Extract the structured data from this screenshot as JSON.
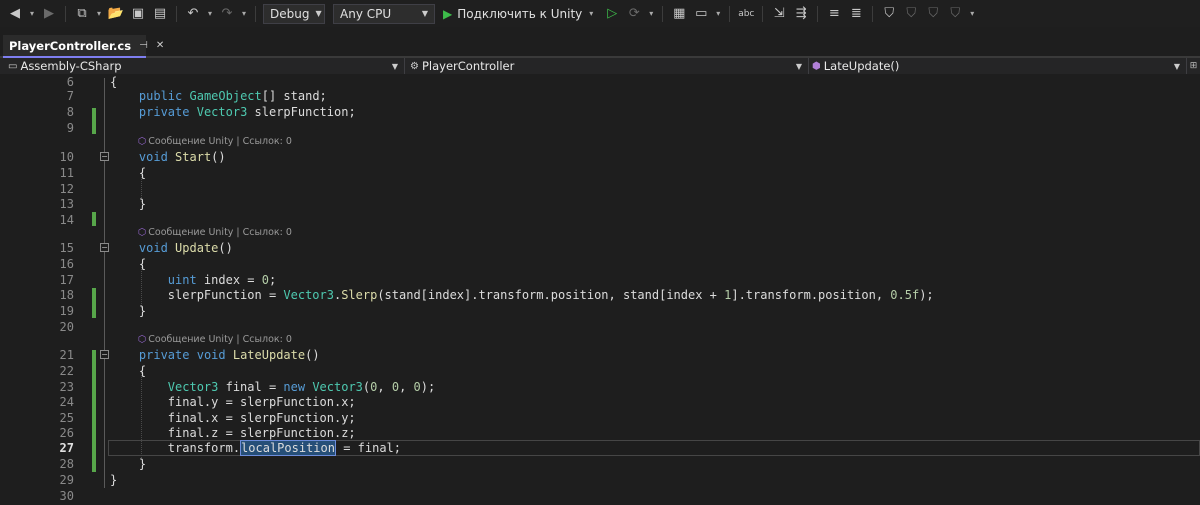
{
  "toolbar": {
    "config": "Debug",
    "platform": "Any CPU",
    "run_label": "Подключить к Unity"
  },
  "tab": {
    "title": "PlayerController.cs",
    "pin_icon": "pin-icon",
    "close_icon": "close-icon"
  },
  "navbar": {
    "project": "Assembly-CSharp",
    "class": "PlayerController",
    "member": "LateUpdate()"
  },
  "codelens": {
    "text": "Сообщение Unity | Ссылок: 0"
  },
  "editor": {
    "current_line": 27,
    "lines": [
      {
        "n": "6",
        "text": "{"
      },
      {
        "n": "7",
        "text": "    public GameObject[] stand;"
      },
      {
        "n": "8",
        "text": "    private Vector3 slerpFunction;"
      },
      {
        "n": "9",
        "text": ""
      },
      {
        "n": "10",
        "text": "    void Start()"
      },
      {
        "n": "11",
        "text": "    {"
      },
      {
        "n": "12",
        "text": ""
      },
      {
        "n": "13",
        "text": "    }"
      },
      {
        "n": "14",
        "text": ""
      },
      {
        "n": "15",
        "text": "    void Update()"
      },
      {
        "n": "16",
        "text": "    {"
      },
      {
        "n": "17",
        "text": "        uint index = 0;"
      },
      {
        "n": "18",
        "text": "        slerpFunction = Vector3.Slerp(stand[index].transform.position, stand[index + 1].transform.position, 0.5f);"
      },
      {
        "n": "19",
        "text": "    }"
      },
      {
        "n": "20",
        "text": ""
      },
      {
        "n": "21",
        "text": "    private void LateUpdate()"
      },
      {
        "n": "22",
        "text": "    {"
      },
      {
        "n": "23",
        "text": "        Vector3 final = new Vector3(0, 0, 0);"
      },
      {
        "n": "24",
        "text": "        final.y = slerpFunction.x;"
      },
      {
        "n": "25",
        "text": "        final.x = slerpFunction.y;"
      },
      {
        "n": "26",
        "text": "        final.z = slerpFunction.z;"
      },
      {
        "n": "27",
        "text": "        transform.localPosition = final;"
      },
      {
        "n": "28",
        "text": "    }"
      },
      {
        "n": "29",
        "text": "}"
      },
      {
        "n": "30",
        "text": ""
      }
    ]
  },
  "colors": {
    "keyword": "#569cd6",
    "type": "#4ec9b0",
    "number": "#b5cea8",
    "method": "#dcdcaa",
    "change_bar": "#57a64a"
  }
}
